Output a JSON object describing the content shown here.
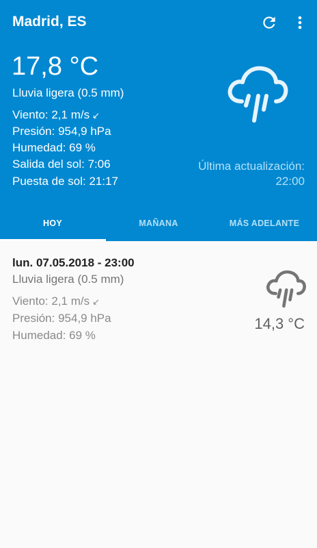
{
  "toolbar": {
    "city": "Madrid, ES",
    "refresh_icon": "refresh-icon",
    "menu_icon": "more-vert-icon"
  },
  "current": {
    "temperature": "17,8 °C",
    "condition": "Lluvia ligera (0.5 mm)",
    "wind": "Viento: 2,1 m/s",
    "wind_arrow": "↙",
    "pressure": "Presión: 954,9 hPa",
    "humidity": "Humedad: 69 %",
    "sunrise": "Salida del sol: 7:06",
    "sunset": "Puesta de sol: 21:17",
    "updated_label": "Última actualización:",
    "updated_time": "22:00",
    "icon": "rain-cloud-icon"
  },
  "tabs": [
    {
      "label": "HOY",
      "selected": true
    },
    {
      "label": "MAÑANA",
      "selected": false
    },
    {
      "label": "MÁS ADELANTE",
      "selected": false
    }
  ],
  "forecast": [
    {
      "datetime": "lun. 07.05.2018 - 23:00",
      "condition": "Lluvia ligera (0.5 mm)",
      "wind": "Viento: 2,1 m/s",
      "wind_arrow": "↙",
      "pressure": "Presión: 954,9 hPa",
      "humidity": "Humedad: 69 %",
      "temperature": "14,3 °C",
      "icon": "rain-cloud-icon"
    }
  ],
  "colors": {
    "primary": "#0288d1",
    "tab_inactive": "#b3e0f7"
  }
}
